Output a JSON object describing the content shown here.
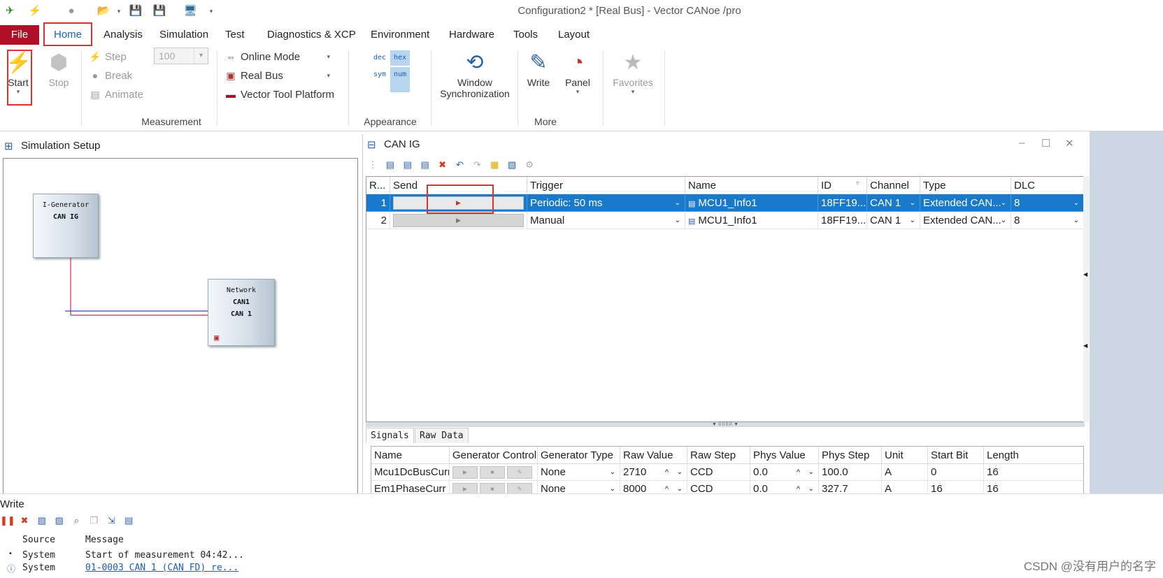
{
  "title": "Configuration2 * [Real Bus] - Vector CANoe /pro",
  "qat_icons": [
    "app-logo-icon",
    "start-icon",
    "stop-icon",
    "open-folder-icon",
    "dropdown-caret-icon",
    "save-icon",
    "save-as-icon",
    "config-icon",
    "customize-icon"
  ],
  "ribbon_tabs": [
    "File",
    "Home",
    "Analysis",
    "Simulation",
    "Test",
    "Diagnostics & XCP",
    "Environment",
    "Hardware",
    "Tools",
    "Layout"
  ],
  "measurement": {
    "start": "Start",
    "stop": "Stop",
    "step": "Step",
    "break": "Break",
    "animate": "Animate",
    "speed_value": "100",
    "online_mode": "Online Mode",
    "real_bus": "Real Bus",
    "vector_tool_platform": "Vector Tool Platform",
    "group": "Measurement"
  },
  "appearance": {
    "dec": "dec",
    "hex": "hex",
    "sym": "sym",
    "num": "num",
    "group": "Appearance"
  },
  "more": {
    "window_sync_1": "Window",
    "window_sync_2": "Synchronization",
    "write": "Write",
    "panel": "Panel",
    "group": "More"
  },
  "favorites": "Favorites",
  "sim_setup": {
    "title": "Simulation Setup",
    "ig_node_line1": "I-Generator",
    "ig_node_line2": "CAN IG",
    "net_node_line1": "Network",
    "net_node_line2": "CAN1",
    "net_node_line3": "CAN 1"
  },
  "can_ig": {
    "title": "CAN IG",
    "columns": [
      "R...",
      "Send",
      "Trigger",
      "Name",
      "ID",
      "Channel",
      "Type",
      "DLC"
    ],
    "rows": [
      {
        "r": "1",
        "trigger": "Periodic: 50 ms",
        "name": "MCU1_Info1",
        "id": "18FF19...",
        "channel": "CAN 1",
        "type": "Extended CAN...",
        "dlc": "8"
      },
      {
        "r": "2",
        "trigger": "Manual",
        "name": "MCU1_Info1",
        "id": "18FF19...",
        "channel": "CAN 1",
        "type": "Extended CAN...",
        "dlc": "8"
      }
    ],
    "sub_tabs": [
      "Signals",
      "Raw Data"
    ],
    "signal_columns": [
      "Name",
      "Generator Control",
      "Generator Type",
      "Raw Value",
      "Raw Step",
      "Phys Value",
      "Phys Step",
      "Unit",
      "Start Bit",
      "Length"
    ],
    "signals": [
      {
        "name": "Mcu1DcBusCurr",
        "gen_type": "None",
        "raw": "2710",
        "raw_step": "CCD",
        "phys": "0.0",
        "phys_step": "100.0",
        "unit": "A",
        "start": "0",
        "len": "16"
      },
      {
        "name": "Em1PhaseCurr",
        "gen_type": "None",
        "raw": "8000",
        "raw_step": "CCD",
        "phys": "0.0",
        "phys_step": "327.7",
        "unit": "A",
        "start": "16",
        "len": "16"
      }
    ]
  },
  "write_window": {
    "title": "Write",
    "col_source": "Source",
    "col_message": "Message",
    "rows": [
      {
        "source": "System",
        "message": "Start of measurement 04:42..."
      },
      {
        "source": "System",
        "message": "01-0003 CAN 1 (CAN FD)  re..."
      }
    ]
  },
  "watermark": "CSDN @没有用户的名字",
  "colors": {
    "file_tab": "#b01028",
    "selection": "#1979ca",
    "highlight_box": "#e03030",
    "link": "#1a5fb4"
  }
}
